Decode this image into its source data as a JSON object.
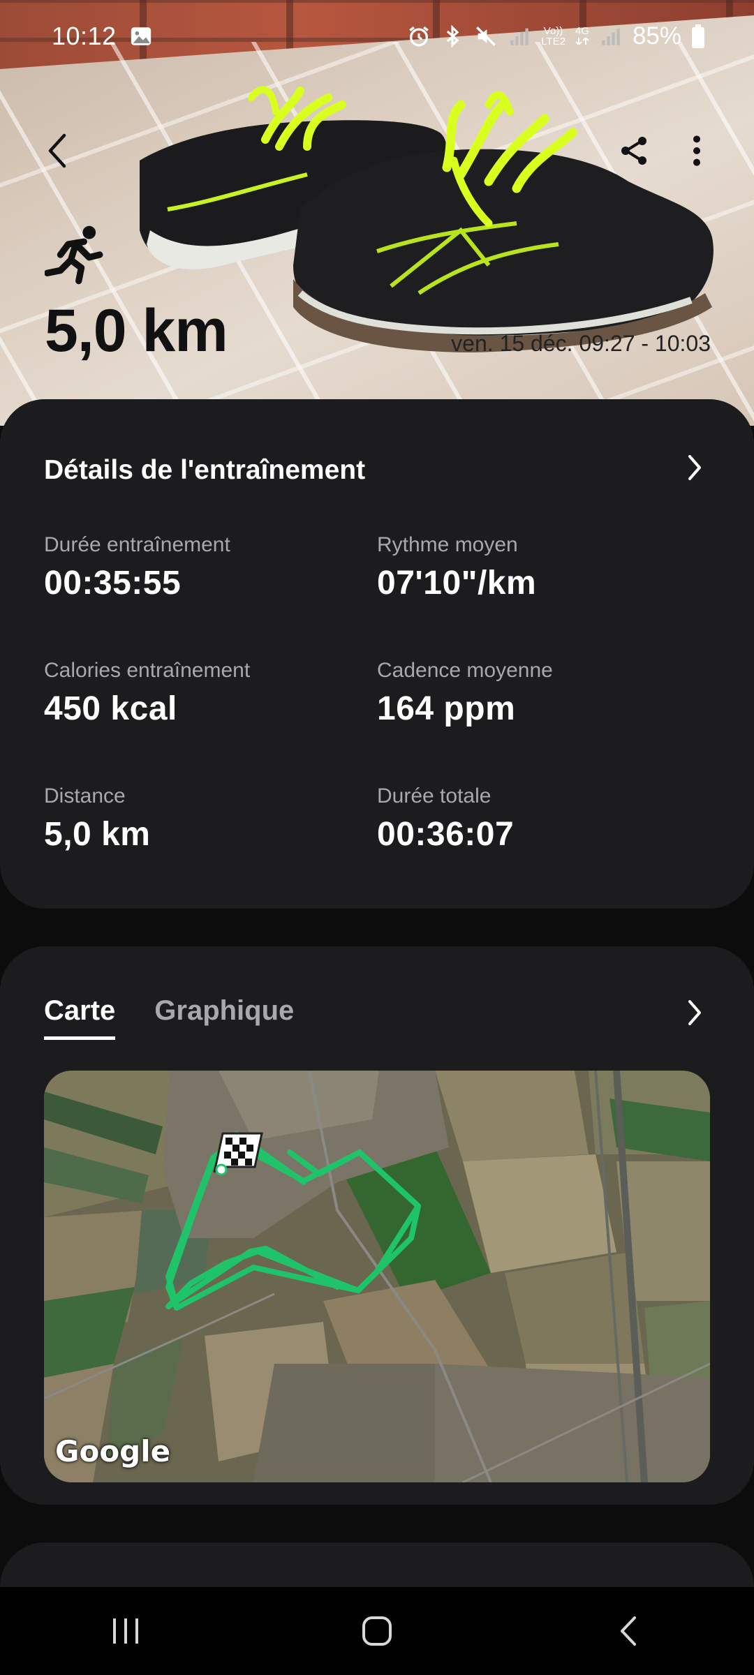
{
  "status_bar": {
    "time": "10:12",
    "battery": "85%",
    "network_top": "Vo))",
    "network_bottom": "LTE2",
    "network_4g": "4G"
  },
  "hero": {
    "distance": "5,0 km",
    "date_range": "ven. 15 déc. 09:27 - 10:03"
  },
  "details": {
    "title": "Détails de l'entraînement",
    "stats": [
      {
        "label": "Durée entraînement",
        "value": "00:35:55"
      },
      {
        "label": "Rythme moyen",
        "value": "07'10\"/km"
      },
      {
        "label": "Calories entraînement",
        "value": "450 kcal"
      },
      {
        "label": "Cadence moyenne",
        "value": "164 ppm"
      },
      {
        "label": "Distance",
        "value": "5,0 km"
      },
      {
        "label": "Durée totale",
        "value": "00:36:07"
      }
    ]
  },
  "map_section": {
    "tabs": [
      {
        "label": "Carte"
      },
      {
        "label": "Graphique"
      }
    ],
    "provider_logo": "Google"
  },
  "colors": {
    "card_background": "#1c1c1e",
    "route": "#1fc36a",
    "secondary_text": "#a9a9ad"
  },
  "icons": [
    "back-icon",
    "share-icon",
    "more-vert-icon",
    "runner-icon",
    "chevron-right-icon",
    "finish-flag-icon",
    "nav-recents-icon",
    "nav-home-icon",
    "nav-back-icon"
  ]
}
